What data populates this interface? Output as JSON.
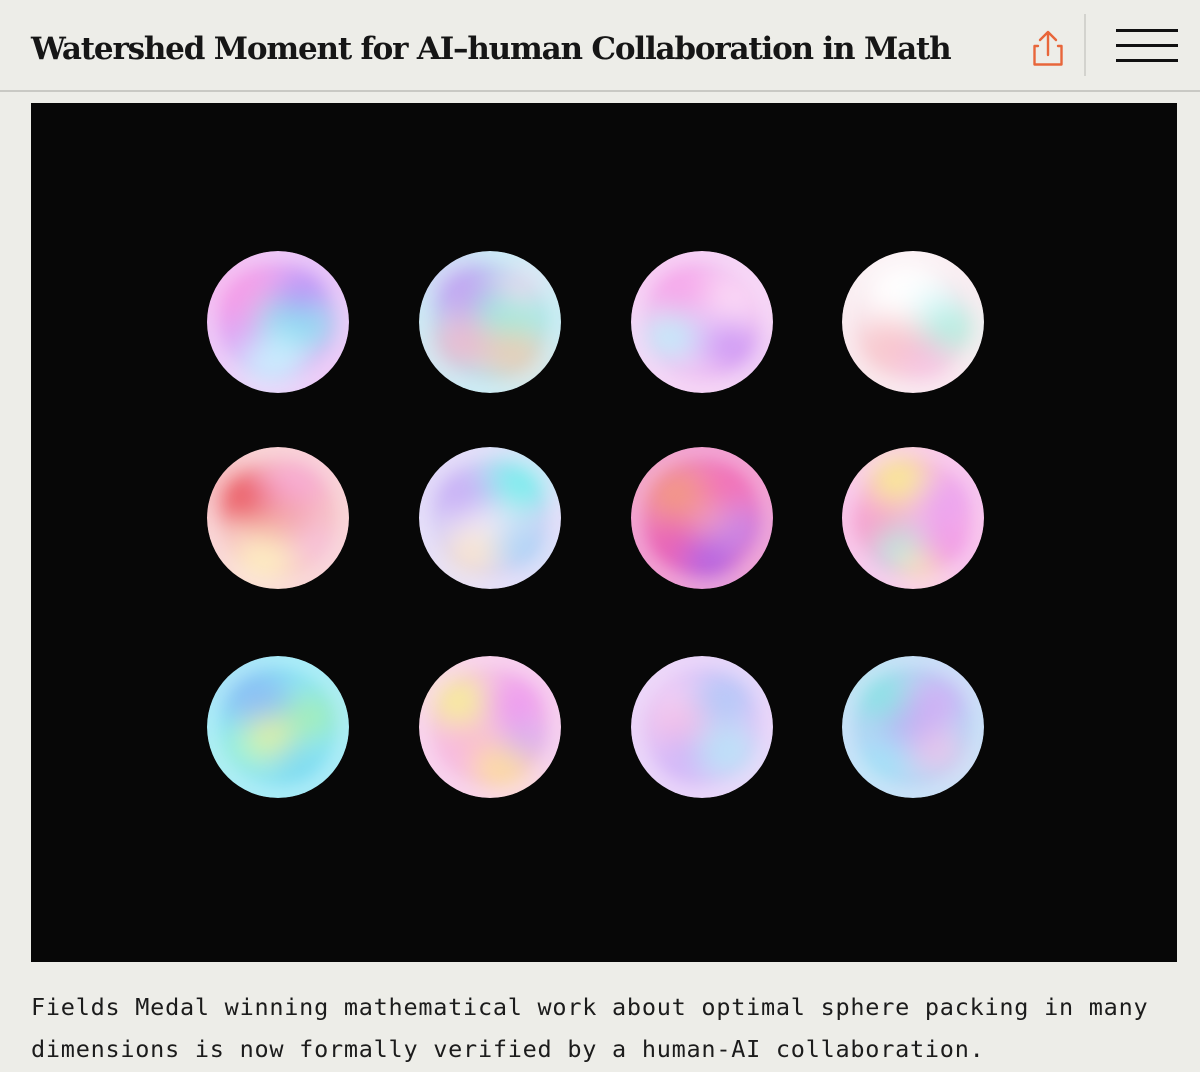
{
  "header": {
    "title": "Watershed Moment for AI–human Collaboration in Math",
    "share_icon": "share-icon",
    "menu_icon": "hamburger-menu-icon",
    "accent_color": "#E8663A"
  },
  "hero_image": {
    "subject": "spheres",
    "rows": 3,
    "columns": 4,
    "background_color": "#070707"
  },
  "caption": {
    "text": "Fields Medal winning mathematical work about optimal sphere packing in many dimensions is now formally verified by a human-AI collaboration."
  }
}
